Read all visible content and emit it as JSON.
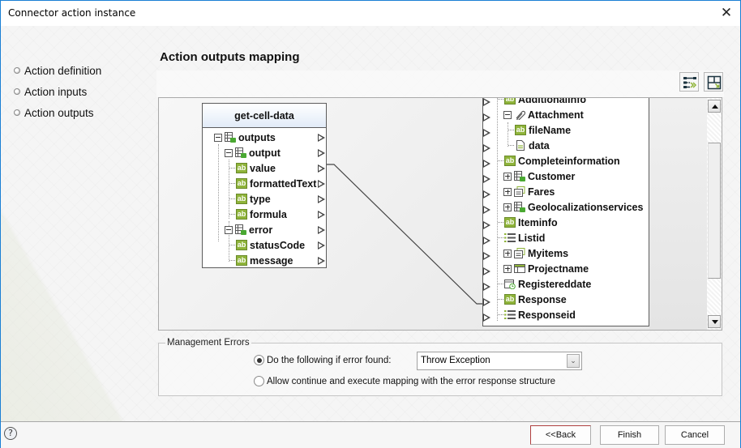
{
  "window": {
    "title": "Connector action instance",
    "close_icon": "close-icon"
  },
  "nav": {
    "items": [
      {
        "label": "Action definition"
      },
      {
        "label": "Action inputs"
      },
      {
        "label": "Action outputs"
      }
    ]
  },
  "main": {
    "section_title": "Action outputs mapping",
    "toolbar": {
      "auto_map_icon": "auto-map-icon",
      "fit_view_icon": "fit-view-icon"
    },
    "source": {
      "title": "get-cell-data",
      "nodes": [
        {
          "label": "outputs",
          "icon": "table-icon",
          "expander": "minus"
        },
        {
          "label": "output",
          "icon": "table-icon",
          "expander": "minus"
        },
        {
          "label": "value",
          "icon": "string-icon"
        },
        {
          "label": "formattedText",
          "icon": "string-icon"
        },
        {
          "label": "type",
          "icon": "string-icon"
        },
        {
          "label": "formula",
          "icon": "string-icon"
        },
        {
          "label": "error",
          "icon": "table-icon",
          "expander": "minus"
        },
        {
          "label": "statusCode",
          "icon": "string-icon"
        },
        {
          "label": "message",
          "icon": "string-icon"
        }
      ]
    },
    "target": {
      "nodes": [
        {
          "label": "Additionalinfo",
          "icon": "string-icon"
        },
        {
          "label": "Attachment",
          "icon": "attachment-icon",
          "expander": "minus"
        },
        {
          "label": "fileName",
          "icon": "string-icon"
        },
        {
          "label": "data",
          "icon": "file-icon"
        },
        {
          "label": "Completeinformation",
          "icon": "string-icon"
        },
        {
          "label": "Customer",
          "icon": "table-icon",
          "expander": "plus"
        },
        {
          "label": "Fares",
          "icon": "form-icon",
          "expander": "plus"
        },
        {
          "label": "Geolocalizationservices",
          "icon": "table-icon",
          "expander": "plus"
        },
        {
          "label": "Iteminfo",
          "icon": "string-icon"
        },
        {
          "label": "Listid",
          "icon": "list-icon"
        },
        {
          "label": "Myitems",
          "icon": "form-icon",
          "expander": "plus"
        },
        {
          "label": "Projectname",
          "icon": "grid-icon",
          "expander": "plus"
        },
        {
          "label": "Registereddate",
          "icon": "date-icon"
        },
        {
          "label": "Response",
          "icon": "string-icon"
        },
        {
          "label": "Responseid",
          "icon": "list-icon"
        }
      ]
    },
    "mappings": [
      {
        "from": "value",
        "to": "Response"
      }
    ]
  },
  "management_errors": {
    "legend": "Management Errors",
    "option_error": "Do the following if error found:",
    "option_error_checked": true,
    "action_value": "Throw Exception",
    "option_continue": "Allow continue and execute mapping with the error response structure",
    "option_continue_checked": false
  },
  "footer": {
    "help_icon": "help-icon",
    "back_label": "<<Back",
    "finish_label": "Finish",
    "cancel_label": "Cancel"
  }
}
